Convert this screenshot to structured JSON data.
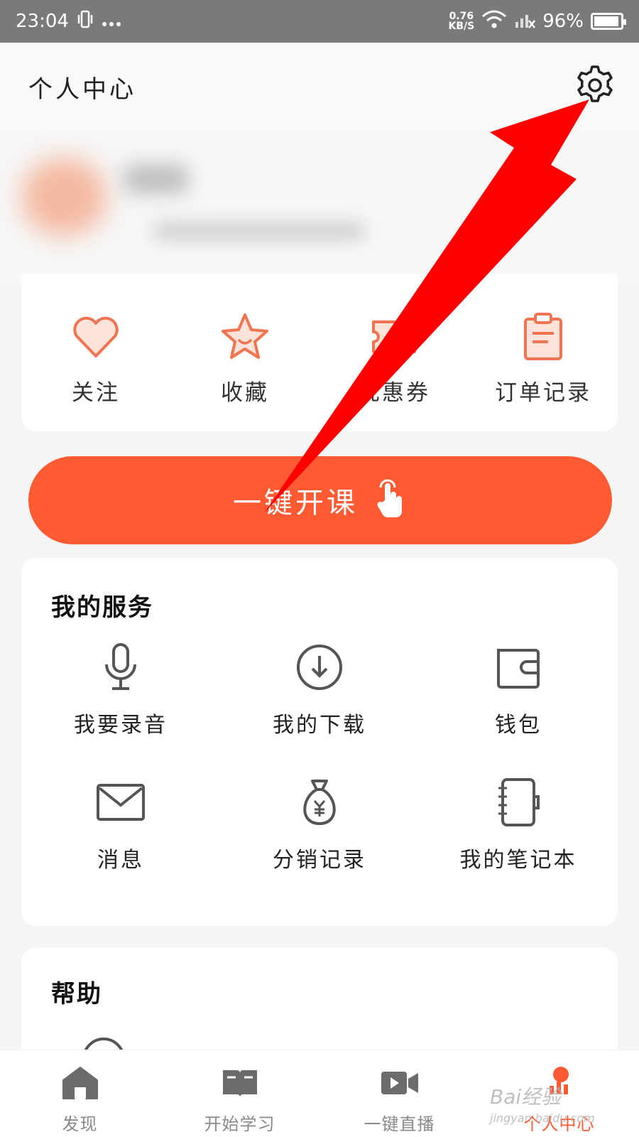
{
  "status_bar": {
    "time": "23:04",
    "net_speed_value": "0.76",
    "net_speed_unit": "KB/S",
    "battery_percent": "96%",
    "battery_level": 0.96
  },
  "header": {
    "title": "个人中心",
    "settings_icon": "gear-icon"
  },
  "quick_actions": [
    {
      "label": "关注",
      "icon": "heart-icon"
    },
    {
      "label": "收藏",
      "icon": "star-icon"
    },
    {
      "label": "优惠券",
      "icon": "ticket-icon"
    },
    {
      "label": "订单记录",
      "icon": "clipboard-icon"
    }
  ],
  "cta": {
    "label": "一键开课",
    "icon": "tap-hand-icon"
  },
  "services": {
    "title": "我的服务",
    "items": [
      {
        "label": "我要录音",
        "icon": "microphone-icon"
      },
      {
        "label": "我的下载",
        "icon": "download-icon"
      },
      {
        "label": "钱包",
        "icon": "wallet-icon"
      },
      {
        "label": "消息",
        "icon": "mail-icon"
      },
      {
        "label": "分销记录",
        "icon": "money-bag-icon"
      },
      {
        "label": "我的笔记本",
        "icon": "notebook-icon"
      }
    ]
  },
  "help": {
    "title": "帮助"
  },
  "tabbar": {
    "active_index": 3,
    "tabs": [
      {
        "label": "发现",
        "icon": "home-icon"
      },
      {
        "label": "开始学习",
        "icon": "book-icon"
      },
      {
        "label": "一键直播",
        "icon": "video-camera-icon"
      },
      {
        "label": "个人中心",
        "icon": "profile-icon"
      }
    ]
  },
  "watermark": {
    "text": "Bai经验",
    "subtext": "jingyan.baidu.com"
  },
  "colors": {
    "accent": "#fe5b33",
    "icon_orange": "#f2734f",
    "annotation_red": "#ff0000"
  }
}
